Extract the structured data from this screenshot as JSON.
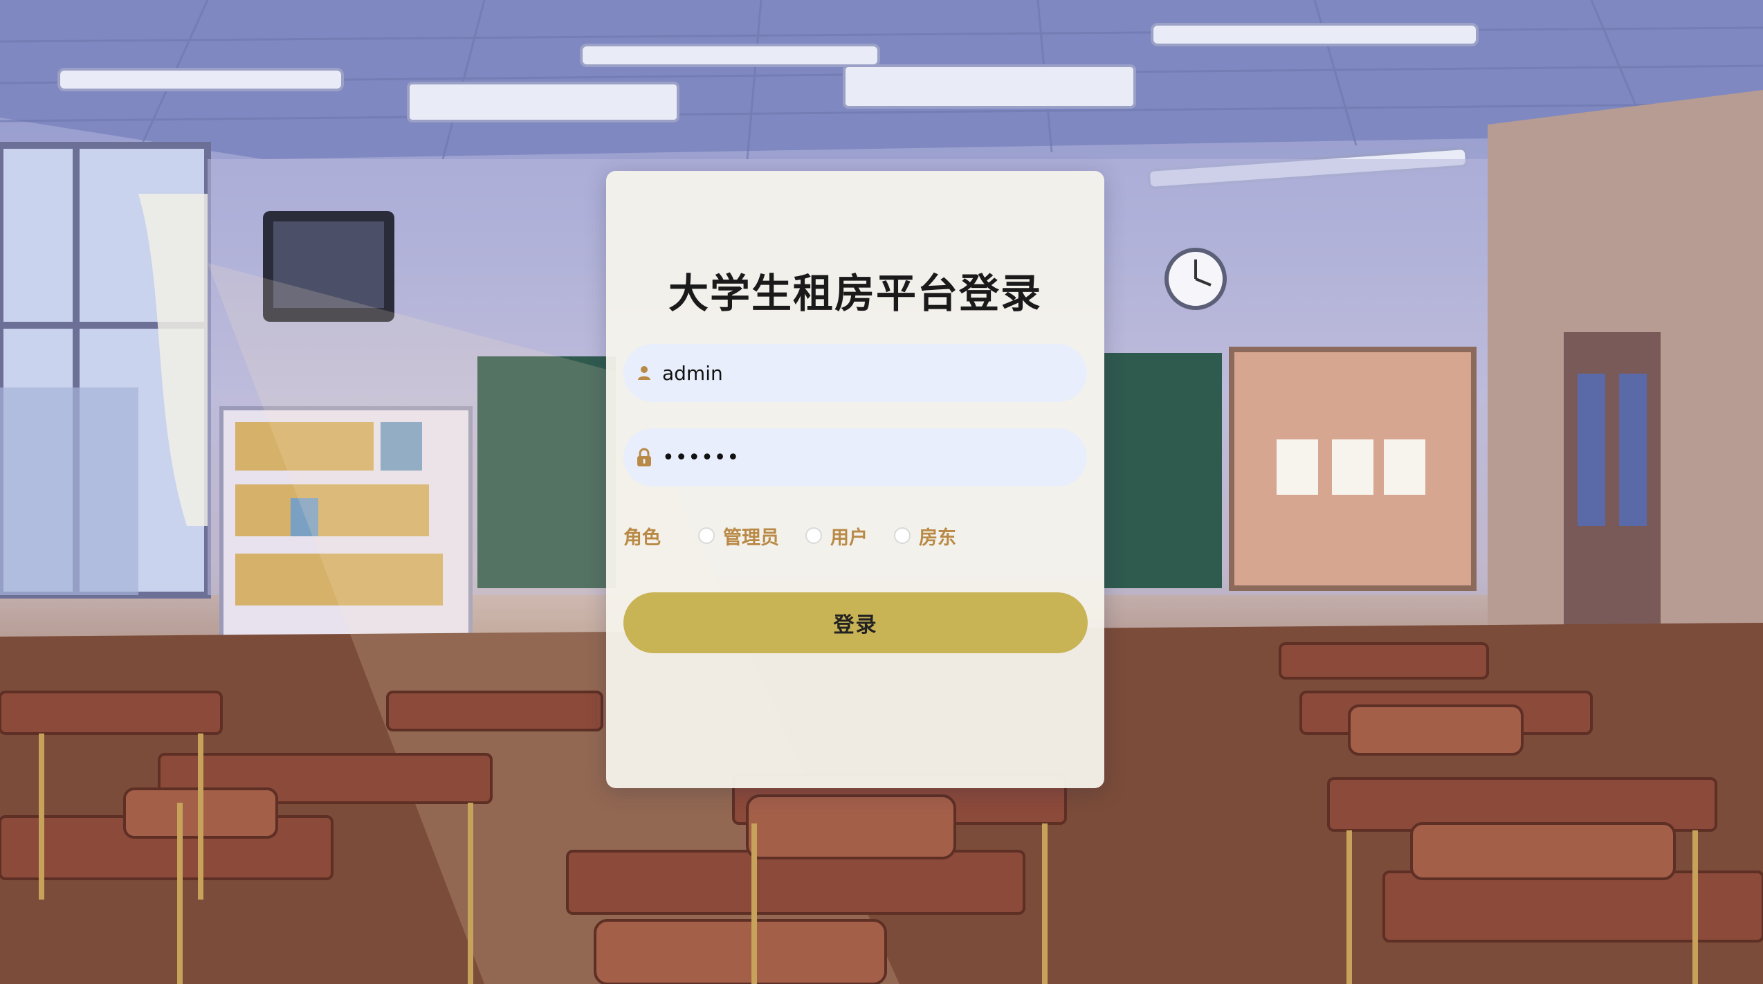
{
  "page": {
    "title": "大学生租房平台登录"
  },
  "login": {
    "username": {
      "value": "admin",
      "icon": "user-icon"
    },
    "password": {
      "value": "••••••",
      "icon": "lock-icon"
    },
    "role": {
      "label": "角色",
      "options": [
        "管理员",
        "用户",
        "房东"
      ],
      "selected": null
    },
    "submit_label": "登录"
  },
  "colors": {
    "panel_bg": "#f5f3ec",
    "input_bg": "#e8eefb",
    "role_text": "#b98946",
    "button_bg": "#c8b355",
    "icon_color": "#b98946"
  }
}
